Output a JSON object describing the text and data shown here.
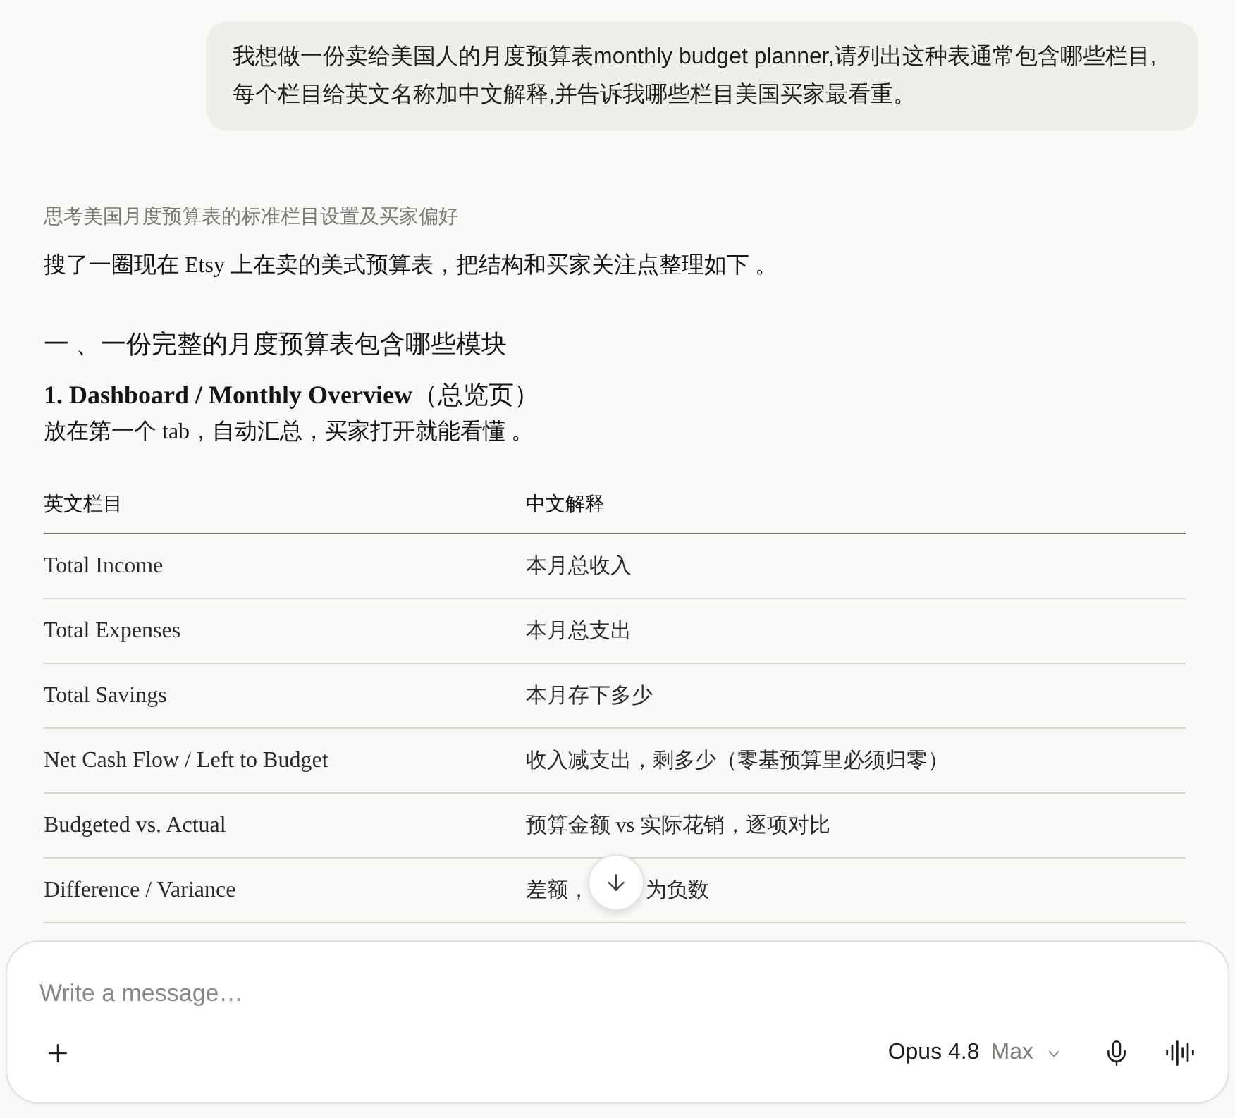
{
  "user_message": {
    "text": "我想做一份卖给美国人的月度预算表monthly budget planner,请列出这种表通常包含哪些栏目,每个栏目给英文名称加中文解释,并告诉我哪些栏目美国买家最看重。"
  },
  "response": {
    "thinking_label": "思考美国月度预算表的标准栏目设置及买家偏好",
    "intro": "搜了一圈现在 Etsy 上在卖的美式预算表，把结构和买家关注点整理如下 。",
    "section_heading": "一 、一份完整的月度预算表包含哪些模块",
    "subsection_title": "**1. Dashboard / Monthly Overview**（总览页）",
    "subsection_description": "放在第一个 tab，自动汇总，买家打开就能看懂 。",
    "table": {
      "columns": [
        "英文栏目",
        "中文解释"
      ],
      "rows": [
        {
          "english": "Total Income",
          "chinese": [
            "本月总收入"
          ]
        },
        {
          "english": "Total Expenses",
          "chinese": [
            "本月总支出"
          ]
        },
        {
          "english": "Total Savings",
          "chinese": [
            "本月存下多少"
          ]
        },
        {
          "english": "Net Cash Flow / Left to Budget",
          "chinese": [
            "收入减支出，剩多少（零基预算里必须归零）"
          ]
        },
        {
          "english": "Budgeted vs. Actual",
          "chinese": [
            "预算金额 vs 实际花销，逐项对比"
          ]
        },
        {
          "english": "Difference / Variance",
          "chinese": [
            "差额，",
            "为负数"
          ]
        }
      ]
    }
  },
  "composer": {
    "placeholder": "Write a message…",
    "model": "Opus 4.8",
    "effort": "Max"
  }
}
